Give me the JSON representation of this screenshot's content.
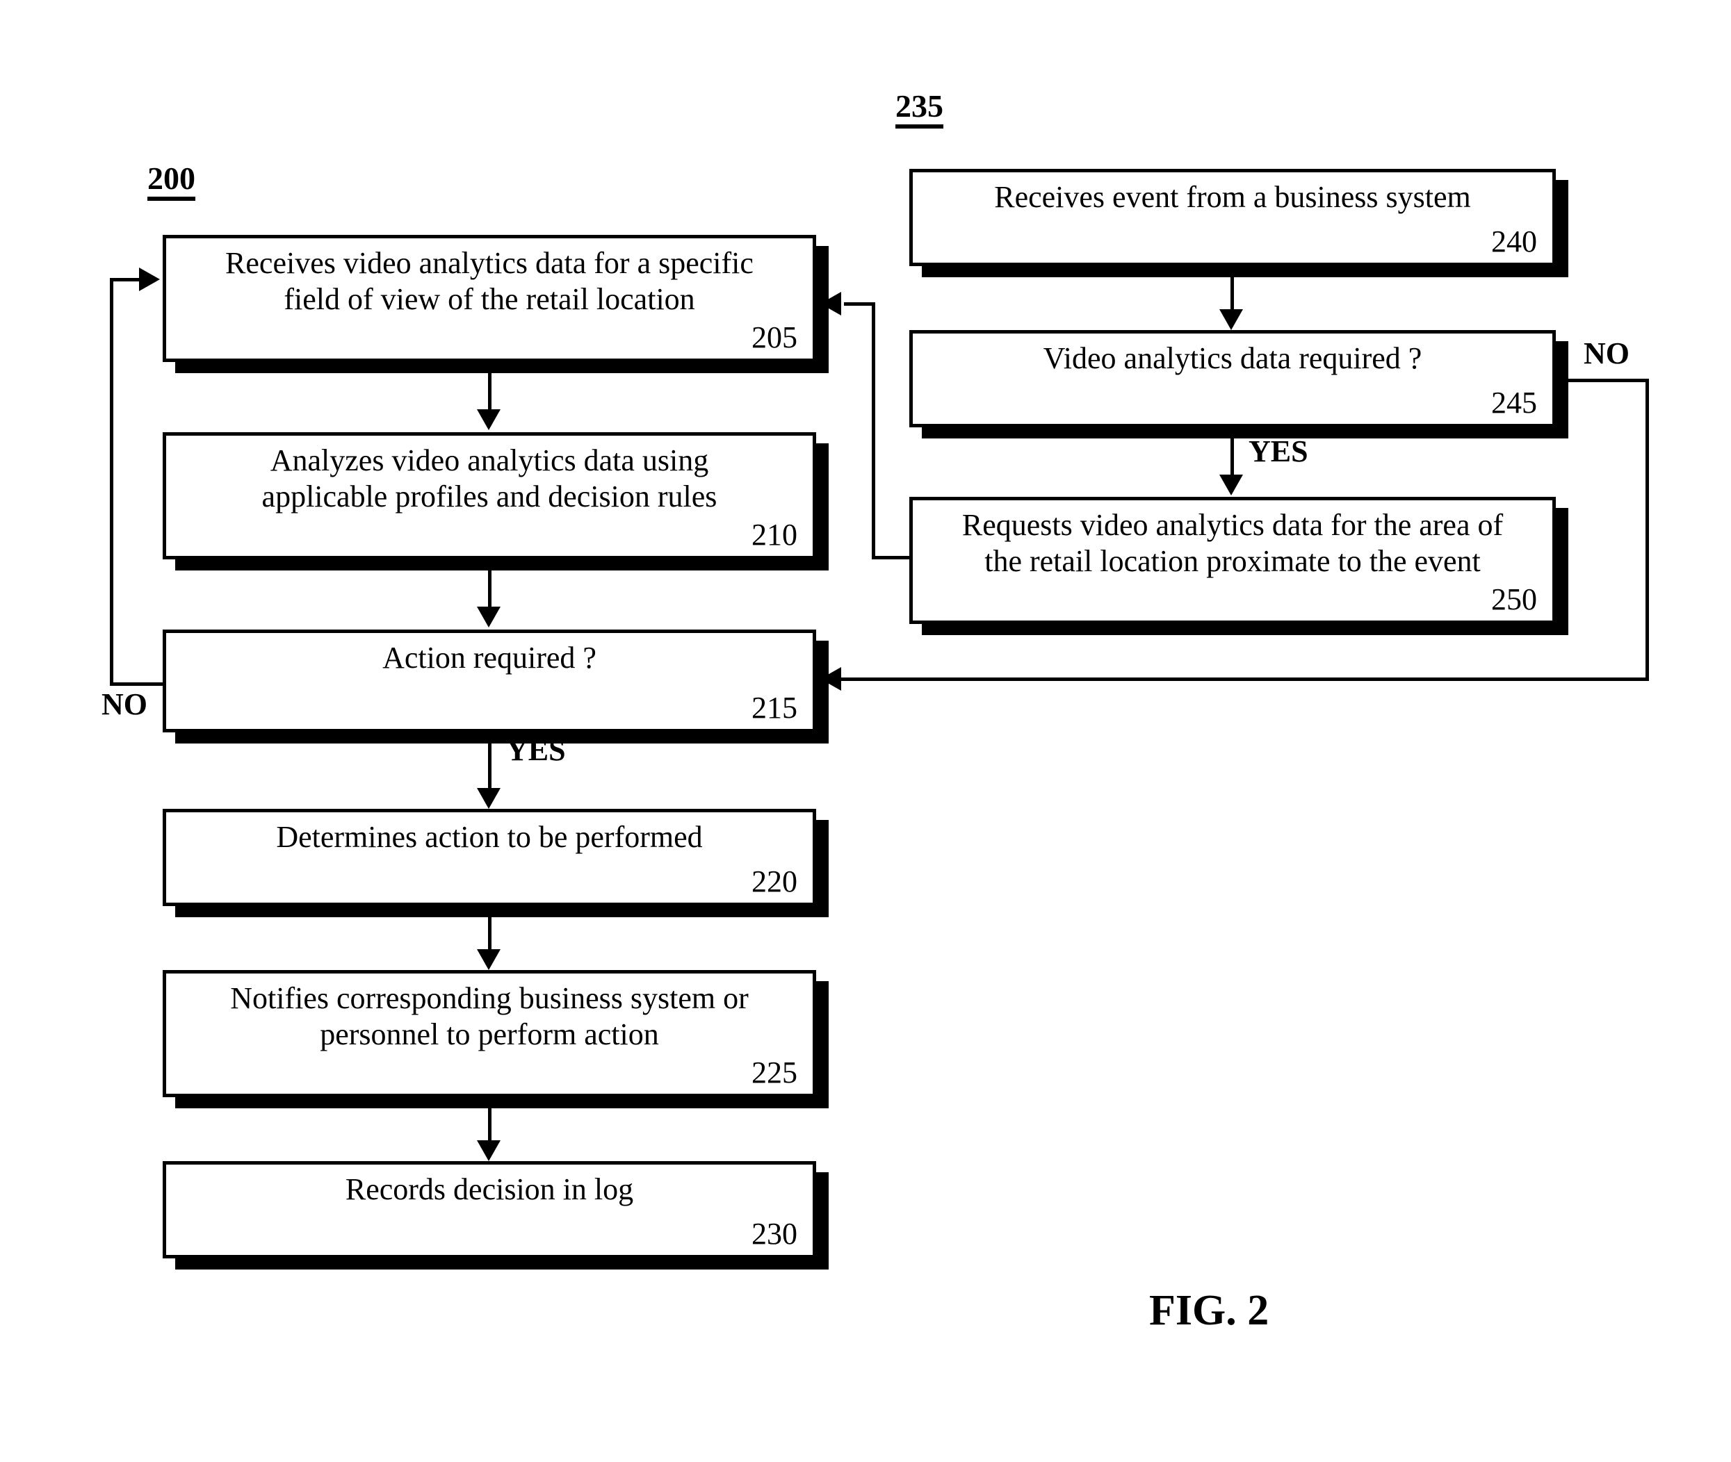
{
  "figure": {
    "caption": "FIG. 2",
    "flow_labels": {
      "left": "200",
      "right": "235"
    }
  },
  "left_flow": {
    "id": "200",
    "steps": [
      {
        "ref": "205",
        "text": "Receives video analytics data for a specific\nfield of view of the retail location",
        "kind": "process"
      },
      {
        "ref": "210",
        "text": "Analyzes video analytics data using\napplicable profiles and decision rules",
        "kind": "process"
      },
      {
        "ref": "215",
        "text": "Action required ?",
        "kind": "decision"
      },
      {
        "ref": "220",
        "text": "Determines action to be performed",
        "kind": "process"
      },
      {
        "ref": "225",
        "text": "Notifies corresponding business system or\npersonnel to perform action",
        "kind": "process"
      },
      {
        "ref": "230",
        "text": "Records decision in log",
        "kind": "process"
      }
    ],
    "branches": {
      "no": "NO",
      "yes": "YES"
    }
  },
  "right_flow": {
    "id": "235",
    "steps": [
      {
        "ref": "240",
        "text": "Receives event from a business system",
        "kind": "process"
      },
      {
        "ref": "245",
        "text": "Video analytics data required ?",
        "kind": "decision"
      },
      {
        "ref": "250",
        "text": "Requests video analytics data for the area of\nthe retail location proximate to the event",
        "kind": "process"
      }
    ],
    "branches": {
      "no": "NO",
      "yes": "YES"
    }
  },
  "colors": {
    "ink": "#000000",
    "paper": "#ffffff"
  }
}
